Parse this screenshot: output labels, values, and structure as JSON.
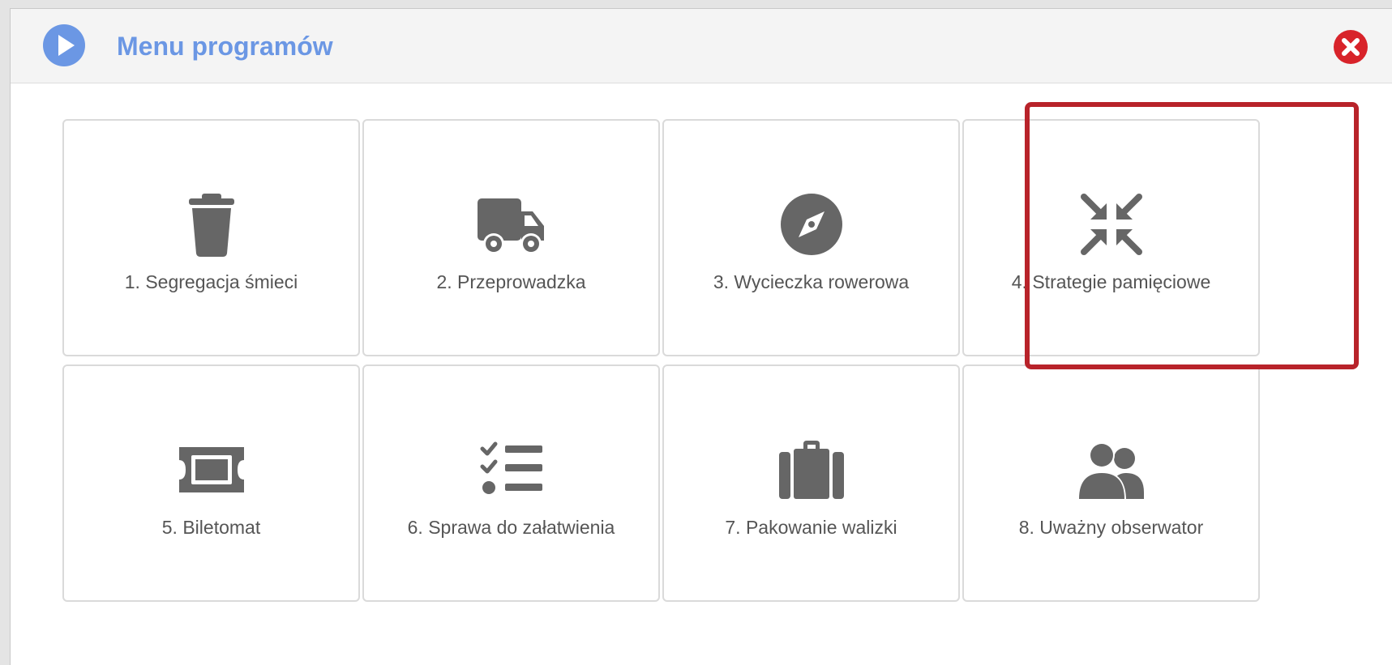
{
  "header": {
    "title": "Menu programów",
    "title_color": "#6b97e4",
    "play_icon": "play-circle-icon",
    "close_icon": "close-circle-icon",
    "close_color": "#d8232a"
  },
  "tiles": [
    {
      "label": "1. Segregacja śmieci",
      "icon": "trash-icon"
    },
    {
      "label": "2. Przeprowadzka",
      "icon": "truck-icon"
    },
    {
      "label": "3. Wycieczka rowerowa",
      "icon": "compass-icon"
    },
    {
      "label": "4. Strategie pamięciowe",
      "icon": "compress-arrows-icon",
      "highlighted": true
    },
    {
      "label": "5. Biletomat",
      "icon": "ticket-icon"
    },
    {
      "label": "6. Sprawa do załatwienia",
      "icon": "task-list-icon"
    },
    {
      "label": "7. Pakowanie walizki",
      "icon": "suitcase-icon"
    },
    {
      "label": "8. Uważny obserwator",
      "icon": "users-icon"
    }
  ],
  "icon_color": "#666666",
  "highlight_color": "#b8232a"
}
